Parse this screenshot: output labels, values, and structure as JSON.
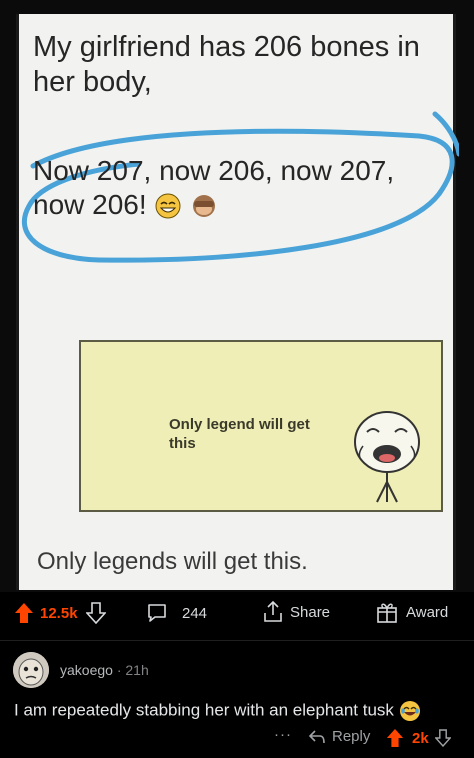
{
  "meme": {
    "line1": "My girlfriend has 206 bones in her body,",
    "line2": "Now 207, now 206, now 207, now 206!",
    "legend_panel_text": "Only legend will get this",
    "footer": "Only legends will get this."
  },
  "post_actions": {
    "vote_count": "12.5k",
    "comment_count": "244",
    "share_label": "Share",
    "award_label": "Award"
  },
  "comment": {
    "username": "yakoego",
    "separator": "·",
    "age": "21h",
    "body": "I am repeatedly stabbing her with an elephant tusk",
    "more_label": "···",
    "reply_label": "Reply",
    "vote_count": "2k"
  },
  "colors": {
    "upvote": "#ff4500",
    "background": "#000000",
    "scribble": "#4aa3d8",
    "panel": "#efeeb6"
  },
  "icons": {
    "upvote": "up-arrow-icon",
    "downvote": "down-arrow-icon",
    "comment": "speech-bubble-icon",
    "share": "share-upload-icon",
    "award": "gift-box-icon",
    "reply": "reply-arrow-icon",
    "emoji": "laughing-emoji-icon"
  }
}
